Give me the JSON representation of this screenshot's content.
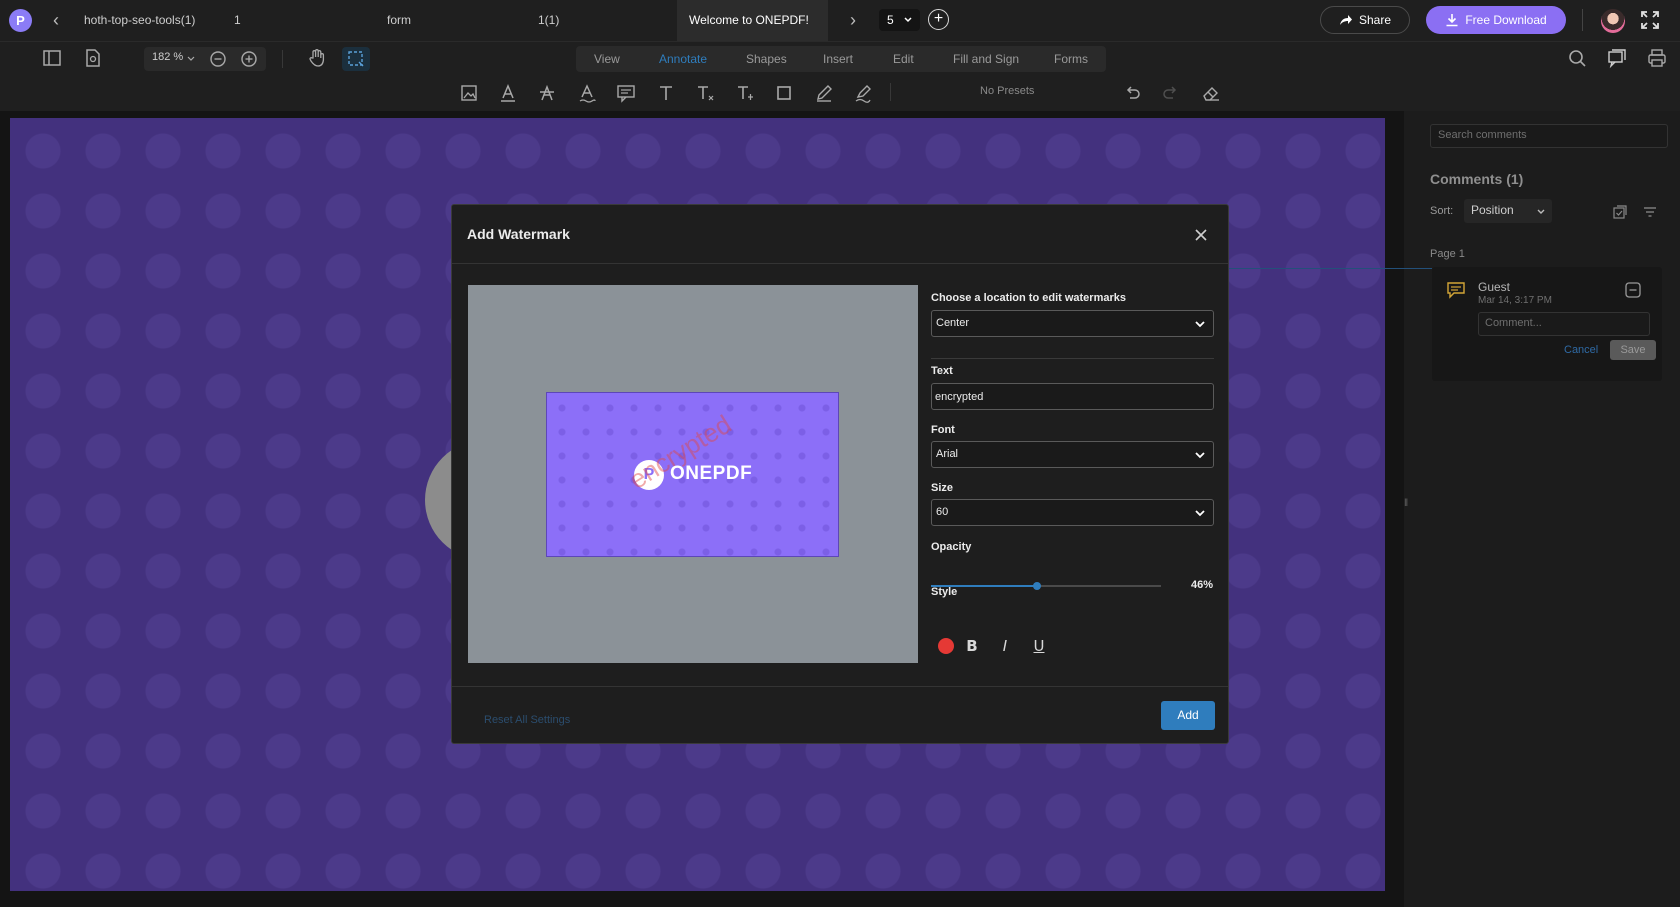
{
  "tabs": {
    "items": [
      {
        "label": "hoth-top-seo-tools(1)"
      },
      {
        "label": "1"
      },
      {
        "label": "form"
      },
      {
        "label": "1(1)"
      },
      {
        "label": "Welcome to ONEPDF!"
      }
    ],
    "page_count": "5",
    "share_label": "Share",
    "download_label": "Free Download"
  },
  "toolbar": {
    "zoom": "182 %",
    "modes": [
      "View",
      "Annotate",
      "Shapes",
      "Insert",
      "Edit",
      "Fill and Sign",
      "Forms"
    ],
    "active_mode": "Annotate",
    "presets": "No Presets"
  },
  "comments": {
    "search_placeholder": "Search comments",
    "title": "Comments (1)",
    "sort_label": "Sort:",
    "sort_value": "Position",
    "page_label": "Page 1",
    "card": {
      "author": "Guest",
      "time": "Mar 14, 3:17 PM",
      "input_placeholder": "Comment...",
      "cancel_label": "Cancel",
      "save_label": "Save"
    }
  },
  "modal": {
    "title": "Add Watermark",
    "location_label": "Choose a location to edit watermarks",
    "location_value": "Center",
    "text_label": "Text",
    "text_value": "encrypted",
    "font_label": "Font",
    "font_value": "Arial",
    "size_label": "Size",
    "size_value": "60",
    "opacity_label": "Opacity",
    "opacity_value": "46%",
    "opacity_fraction": 0.46,
    "style_label": "Style",
    "style_color": "#e53935",
    "style_buttons": {
      "bold": "B",
      "italic": "I",
      "underline": "U"
    },
    "reset_label": "Reset All Settings",
    "add_label": "Add",
    "preview": {
      "logo_glyph": "P",
      "brand": "ONEPDF",
      "watermark_text": "encrypted"
    }
  },
  "colors": {
    "accent": "#2f7dbd",
    "brand": "#8b6ff3",
    "document_background": "#43317e"
  },
  "icons": [
    "app-logo-icon",
    "chevron-left-icon",
    "chevron-right-icon",
    "chevron-down-icon",
    "plus-icon",
    "share-icon",
    "download-icon",
    "fullscreen-icon",
    "sidebar-icon",
    "page-settings-icon",
    "zoom-out-icon",
    "zoom-in-icon",
    "hand-icon",
    "select-icon",
    "search-icon",
    "comments-icon",
    "print-icon",
    "undo-icon",
    "redo-icon",
    "eraser-icon",
    "close-icon",
    "comment-bubble-icon",
    "collapse-icon",
    "filter-icon"
  ]
}
